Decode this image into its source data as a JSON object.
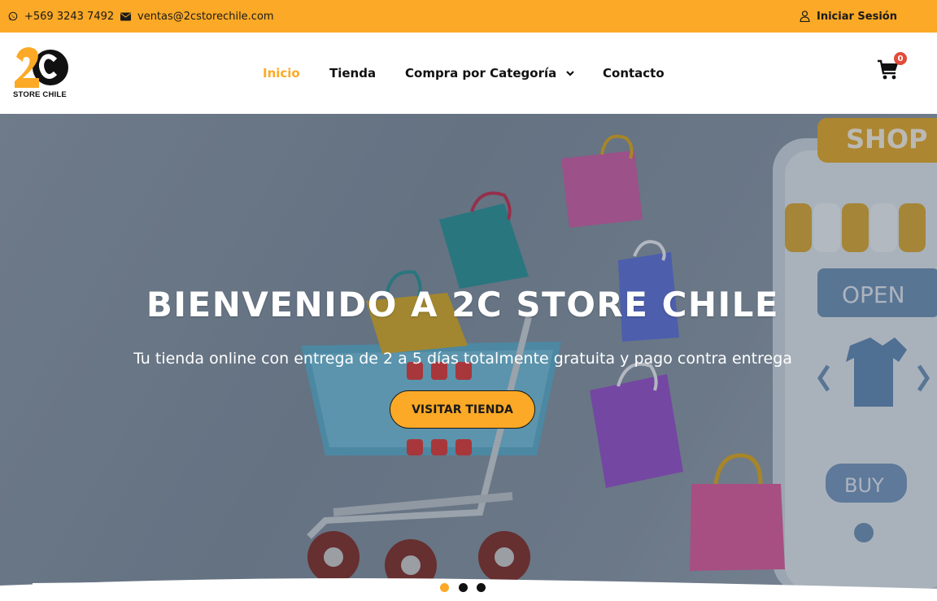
{
  "topbar": {
    "phone": "+569 3243 7492",
    "email": "ventas@2cstorechile.com",
    "login": "Iniciar Sesión",
    "background": "#fba926"
  },
  "logo": {
    "text": "STORE CHILE"
  },
  "nav": {
    "items": [
      {
        "label": "Inicio",
        "active": true
      },
      {
        "label": "Tienda",
        "active": false
      },
      {
        "label": "Compra por Categoría",
        "active": false,
        "has_dropdown": true
      },
      {
        "label": "Contacto",
        "active": false
      }
    ],
    "active_color": "#fba926"
  },
  "cart": {
    "count": "0",
    "icon": "cart-icon"
  },
  "hero": {
    "title": "BIENVENIDO A 2C STORE CHILE",
    "subtitle": "Tu tienda online con entrega de 2 a 5 días totalmente gratuita y pago contra entrega",
    "button": "VISITAR TIENDA",
    "illustration": {
      "shop_sign": "SHOP",
      "open_sign": "OPEN",
      "buy_button": "BUY"
    },
    "slides_total": 3,
    "active_slide": 1
  }
}
